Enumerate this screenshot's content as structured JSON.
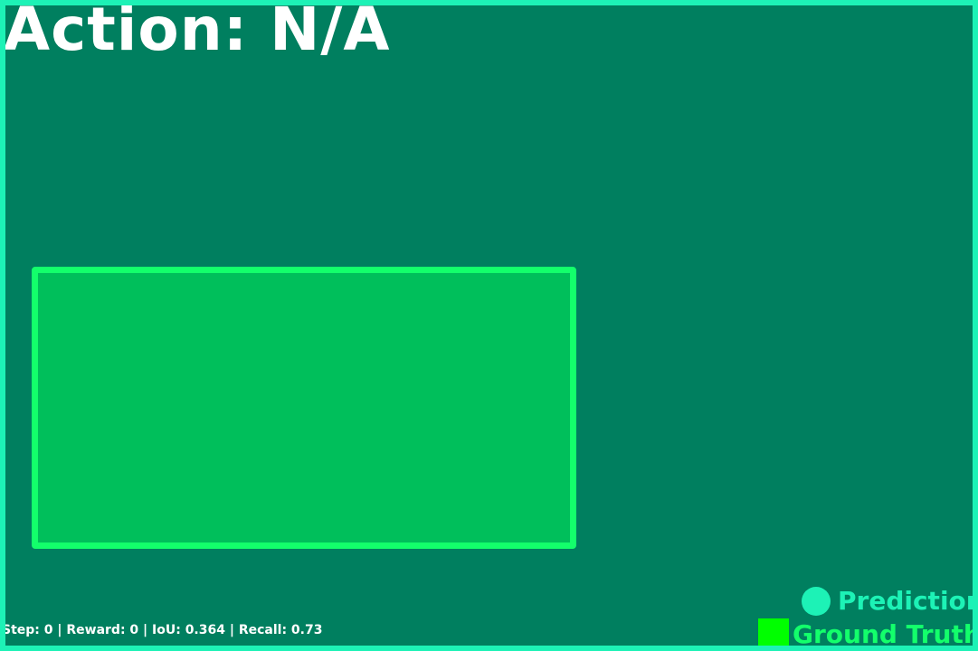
{
  "title": "Action: N/A",
  "status": "Step: 0 | Reward: 0 | IoU: 0.364 | Recall: 0.73",
  "legend": {
    "prediction": "Prediction",
    "ground_truth": "Ground Truth"
  },
  "colors": {
    "background": "#007f5f",
    "prediction": "#1df2b6",
    "ground_truth_outline": "#13ff6b",
    "ground_truth_fill": "#00bf5b",
    "ground_truth_legend": "#00ff00",
    "text": "#ffffff"
  }
}
